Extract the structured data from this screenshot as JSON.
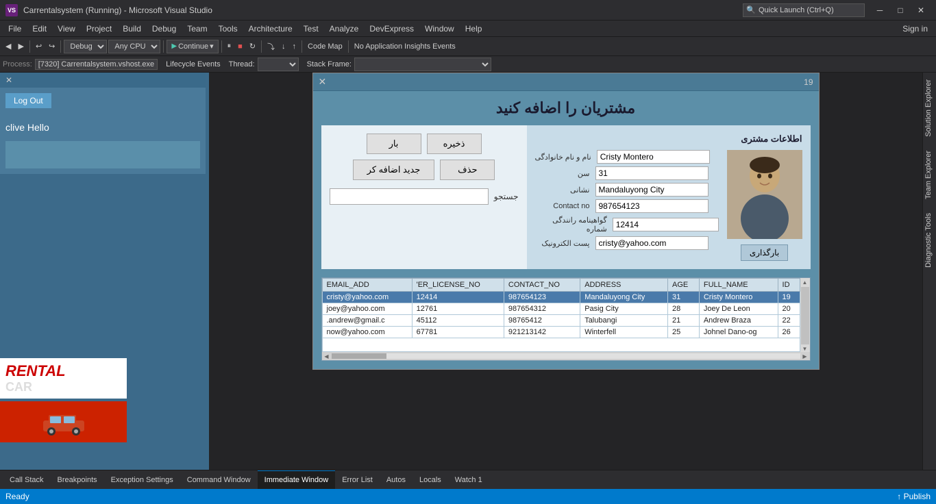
{
  "titlebar": {
    "logo": "VS",
    "title": "Carrentalsystem (Running) - Microsoft Visual Studio",
    "min_btn": "─",
    "max_btn": "□",
    "close_btn": "✕"
  },
  "menubar": {
    "items": [
      "File",
      "Edit",
      "View",
      "Project",
      "Build",
      "Debug",
      "Team",
      "Tools",
      "Architecture",
      "Test",
      "Analyze",
      "DevExpress",
      "Window",
      "Help"
    ]
  },
  "toolbar": {
    "debug_label": "Debug",
    "cpu_label": "Any CPU",
    "continue_label": "Continue",
    "code_map": "Code Map",
    "insights": "No Application Insights Events"
  },
  "processbar": {
    "process_label": "Process:",
    "process_value": "[7320] Carrentalsystem.vshost.exe",
    "lifecycle_label": "Lifecycle Events",
    "thread_label": "Thread:",
    "stack_label": "Stack Frame:"
  },
  "modal": {
    "close_btn": "✕",
    "number": "19",
    "title": "مشتریان را اضافه کنید",
    "info_title": "اطلاعات مشتری",
    "buttons": {
      "load": "بار",
      "save": "ذخیره",
      "delete": "حذف",
      "add_new": "جدید اضافه کر"
    },
    "search_label": "جستجو",
    "upload_btn": "بارگذاری",
    "fields": {
      "name_label": "نام و نام خانوادگی",
      "age_label": "سن",
      "address_label": "نشانی",
      "contact_label": "Contact no",
      "license_label": "گواهینامه رانندگی شماره",
      "email_label": "پست الکترونیک",
      "name_value": "Cristy Montero",
      "age_value": "31",
      "address_value": "Mandaluyong City",
      "contact_value": "987654123",
      "license_value": "12414",
      "email_value": "cristy@yahoo.com"
    }
  },
  "table": {
    "columns": [
      "ID",
      "FULL_NAME",
      "AGE",
      "ADDRESS",
      "CONTACT_NO",
      "'ER_LICENSE_NO",
      "EMAIL_ADD"
    ],
    "rows": [
      {
        "id": "19",
        "full_name": "Cristy Montero",
        "age": "31",
        "address": "Mandaluyong City",
        "contact_no": "987654123",
        "license_no": "12414",
        "email": "cristy@yahoo.com",
        "selected": true
      },
      {
        "id": "20",
        "full_name": "Joey De Leon",
        "age": "28",
        "address": "Pasig City",
        "contact_no": "987654312",
        "license_no": "12761",
        "email": "joey@yahoo.com",
        "selected": false
      },
      {
        "id": "22",
        "full_name": "Andrew Braza",
        "age": "21",
        "address": "Talubangi",
        "contact_no": "98765412",
        "license_no": "45112",
        "email": ".andrew@gmail.c",
        "selected": false
      },
      {
        "id": "26",
        "full_name": "Johnel Dano-og",
        "age": "25",
        "address": "Winterfell",
        "contact_no": "921213142",
        "license_no": "67781",
        "email": "now@yahoo.com",
        "selected": false
      }
    ]
  },
  "left_panel": {
    "close_btn": "✕",
    "logout_btn": "Log Out",
    "user_greeting": "clive  Hello",
    "rental_text": "RENTAL",
    "car_text": "CAR"
  },
  "debug_tabs": {
    "tabs": [
      "Call Stack",
      "Breakpoints",
      "Exception Settings",
      "Command Window",
      "Immediate Window",
      "Error List",
      "Autos",
      "Locals",
      "Watch 1"
    ]
  },
  "statusbar": {
    "ready": "Ready",
    "publish": "↑ Publish"
  },
  "right_sidebar": {
    "items": [
      "Solution Explorer",
      "Team Explorer",
      "Diagnostic Tools"
    ]
  },
  "search": {
    "placeholder": "Quick Launch (Ctrl+Q)"
  }
}
